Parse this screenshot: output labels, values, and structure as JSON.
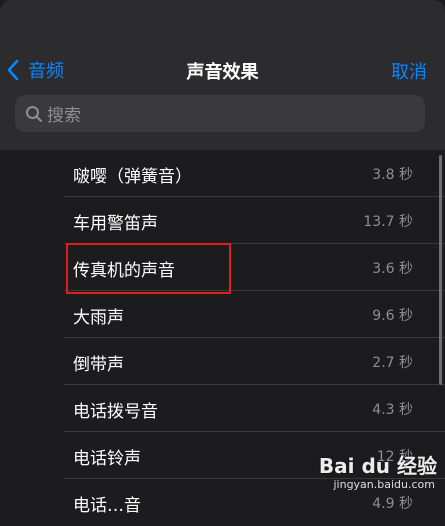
{
  "nav": {
    "back_label": "音频",
    "title": "声音效果",
    "cancel_label": "取消"
  },
  "search": {
    "placeholder": "搜索"
  },
  "sounds": [
    {
      "label": "啵嘤（弹簧音）",
      "duration": "3.8 秒"
    },
    {
      "label": "车用警笛声",
      "duration": "13.7 秒"
    },
    {
      "label": "传真机的声音",
      "duration": "3.6 秒"
    },
    {
      "label": "大雨声",
      "duration": "9.6 秒"
    },
    {
      "label": "倒带声",
      "duration": "2.7 秒"
    },
    {
      "label": "电话拨号音",
      "duration": "4.3 秒"
    },
    {
      "label": "电话铃声",
      "duration": "12 秒"
    },
    {
      "label": "电话…音",
      "duration": "4.9 秒"
    }
  ],
  "watermark": {
    "logo": "Bai du 经验",
    "sub": "jingyan.baidu.com"
  },
  "colors": {
    "accent": "#0a84ff",
    "background": "#1c1c1e",
    "highlight_box": "#e02020"
  }
}
